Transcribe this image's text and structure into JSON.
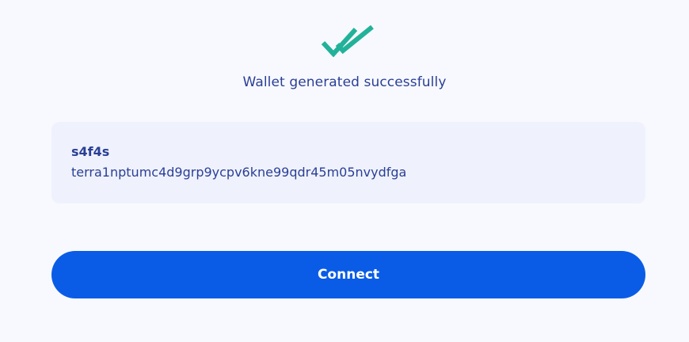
{
  "status": {
    "icon": "double-check-icon",
    "title": "Wallet generated successfully",
    "icon_color": "#22b29a"
  },
  "wallet": {
    "name": "s4f4s",
    "address": "terra1nptumc4d9grp9ycpv6kne99qdr45m05nvydfga"
  },
  "actions": {
    "connect_label": "Connect"
  },
  "colors": {
    "background": "#f8f9fe",
    "card_background": "#eff2fc",
    "text": "#2a3f96",
    "button": "#0a5ce6",
    "button_text": "#ffffff"
  }
}
